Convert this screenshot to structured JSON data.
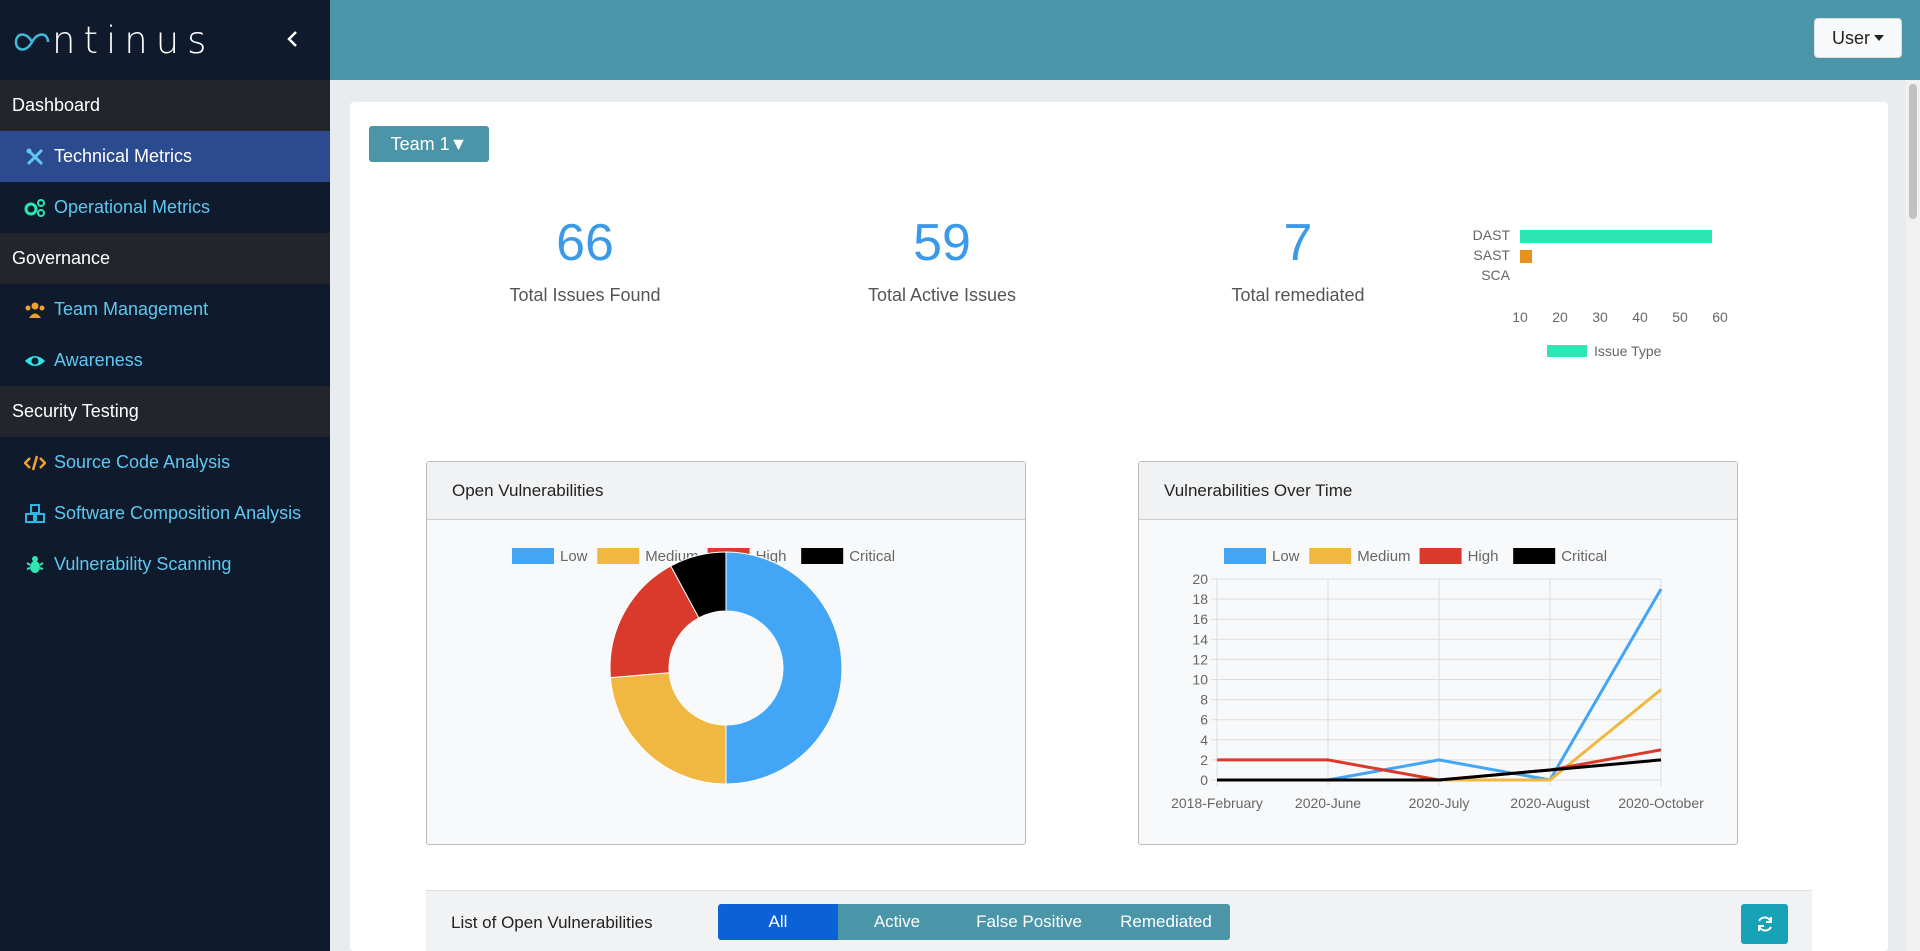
{
  "brand": {
    "logo_c": "c",
    "logo_rest": "ntinus"
  },
  "sidebar": {
    "sections": [
      {
        "title": "Dashboard",
        "items": [
          {
            "label": "Technical Metrics",
            "icon": "tools-icon",
            "active": true
          },
          {
            "label": "Operational Metrics",
            "icon": "gears-icon",
            "active": false
          }
        ]
      },
      {
        "title": "Governance",
        "items": [
          {
            "label": "Team Management",
            "icon": "users-icon",
            "active": false
          },
          {
            "label": "Awareness",
            "icon": "eye-icon",
            "active": false
          }
        ]
      },
      {
        "title": "Security Testing",
        "items": [
          {
            "label": "Source Code Analysis",
            "icon": "code-icon",
            "active": false
          },
          {
            "label": "Software Composition Analysis",
            "icon": "cubes-icon",
            "active": false
          },
          {
            "label": "Vulnerability Scanning",
            "icon": "bug-icon",
            "active": false
          }
        ]
      }
    ]
  },
  "topbar": {
    "user_label": "User"
  },
  "team_selector": {
    "label": "Team 1▼"
  },
  "stats": [
    {
      "value": "66",
      "label": "Total Issues Found"
    },
    {
      "value": "59",
      "label": "Total Active Issues"
    },
    {
      "value": "7",
      "label": "Total remediated"
    }
  ],
  "chart_data": [
    {
      "type": "bar",
      "orientation": "horizontal",
      "categories": [
        "DAST",
        "SAST",
        "SCA"
      ],
      "series": [
        {
          "name": "Issue Type",
          "values": [
            58,
            1,
            0
          ]
        }
      ],
      "xlim": [
        10,
        60
      ],
      "xticks": [
        10,
        20,
        30,
        40,
        50,
        60
      ],
      "legend": "bottom",
      "colors": [
        "#2ee6b4",
        "#e8921c",
        "#2ee6b4"
      ]
    },
    {
      "type": "pie",
      "title": "Open Vulnerabilities",
      "donut": true,
      "categories": [
        "Low",
        "Medium",
        "High",
        "Critical"
      ],
      "values": [
        19,
        9,
        7,
        3
      ],
      "colors": [
        "#42a5f5",
        "#f0b840",
        "#d93a2b",
        "#000000"
      ],
      "legend": "top"
    },
    {
      "type": "line",
      "title": "Vulnerabilities Over Time",
      "x": [
        "2018-February",
        "2020-June",
        "2020-July",
        "2020-August",
        "2020-October"
      ],
      "series": [
        {
          "name": "Low",
          "values": [
            0,
            0,
            2,
            0,
            19
          ],
          "color": "#42a5f5"
        },
        {
          "name": "Medium",
          "values": [
            0,
            0,
            0,
            0,
            9
          ],
          "color": "#f0b840"
        },
        {
          "name": "High",
          "values": [
            2,
            2,
            0,
            1,
            3
          ],
          "color": "#d93a2b"
        },
        {
          "name": "Critical",
          "values": [
            0,
            0,
            0,
            1,
            2
          ],
          "color": "#000000"
        }
      ],
      "ylim": [
        0,
        20
      ],
      "yticks": [
        0,
        2,
        4,
        6,
        8,
        10,
        12,
        14,
        16,
        18,
        20
      ],
      "grid": true,
      "legend": "top"
    }
  ],
  "list": {
    "title": "List of Open Vulnerabilities",
    "filters": [
      "All",
      "Active",
      "False Positive",
      "Remediated"
    ],
    "selected": "All"
  }
}
